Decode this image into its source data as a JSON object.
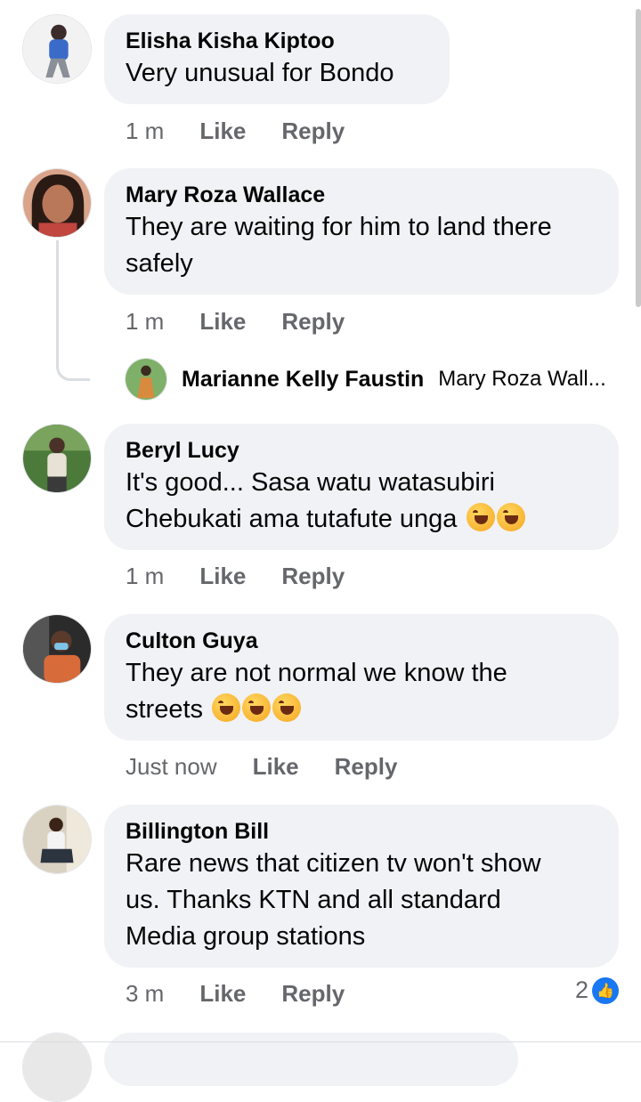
{
  "comments": [
    {
      "author": "Elisha Kisha Kiptoo",
      "text": "Very unusual for Bondo",
      "time": "1 m",
      "like": "Like",
      "reply": "Reply"
    },
    {
      "author": "Mary Roza Wallace",
      "text_lines": [
        "They are waiting for him to land there",
        "safely"
      ],
      "time": "1 m",
      "like": "Like",
      "reply": "Reply"
    },
    {
      "author": "Beryl Lucy",
      "text_lines": [
        "It's good... Sasa watu watasubiri",
        "Chebukati ama tutafute unga"
      ],
      "time": "1 m",
      "like": "Like",
      "reply": "Reply"
    },
    {
      "author": "Culton Guya",
      "text_lines": [
        "They are not normal we know the",
        "streets"
      ],
      "time": "Just now",
      "like": "Like",
      "reply": "Reply"
    },
    {
      "author": "Billington Bill",
      "text_lines": [
        "Rare news that citizen tv won't show",
        "us. Thanks KTN and all standard",
        "Media group stations"
      ],
      "time": "3 m",
      "like": "Like",
      "reply": "Reply",
      "reaction_count": "2"
    }
  ],
  "reply_preview": {
    "author": "Marianne Kelly Faustin",
    "snippet": "Mary Roza Wall..."
  },
  "colors": {
    "bubble": "#f0f2f5",
    "meta": "#65676b",
    "like_blue": "#1877f2"
  },
  "icons": {
    "emoji": "rolling-laughing-emoji-icon",
    "like": "like-thumb-icon"
  }
}
